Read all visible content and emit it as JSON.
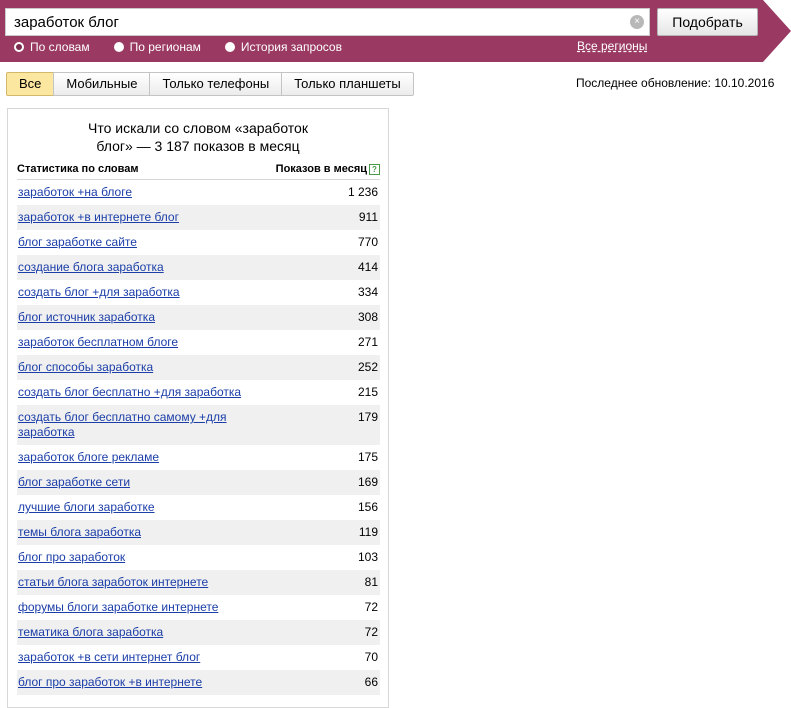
{
  "search": {
    "query": "заработок блог",
    "submit_label": "Подобрать",
    "modes": [
      "По словам",
      "По регионам",
      "История запросов"
    ],
    "regions_link": "Все регионы",
    "clear_symbol": "×"
  },
  "tabs": [
    "Все",
    "Мобильные",
    "Только телефоны",
    "Только планшеты"
  ],
  "last_update": "Последнее обновление: 10.10.2016",
  "panel": {
    "title_line1": "Что искали со словом «заработок",
    "title_line2": "блог» — 3 187 показов в месяц",
    "col_phrase": "Статистика по словам",
    "col_count": "Показов в месяц",
    "help_symbol": "?"
  },
  "rows": [
    {
      "phrase": "заработок +на блоге",
      "count": "1 236"
    },
    {
      "phrase": "заработок +в интернете блог",
      "count": "911"
    },
    {
      "phrase": "блог заработке сайте",
      "count": "770"
    },
    {
      "phrase": "создание блога заработка",
      "count": "414"
    },
    {
      "phrase": "создать блог +для заработка",
      "count": "334"
    },
    {
      "phrase": "блог источник заработка",
      "count": "308"
    },
    {
      "phrase": "заработок бесплатном блоге",
      "count": "271"
    },
    {
      "phrase": "блог способы заработка",
      "count": "252"
    },
    {
      "phrase": "создать блог бесплатно +для заработка",
      "count": "215"
    },
    {
      "phrase": "создать блог бесплатно самому +для заработка",
      "count": "179"
    },
    {
      "phrase": "заработок блоге рекламе",
      "count": "175"
    },
    {
      "phrase": "блог заработке сети",
      "count": "169"
    },
    {
      "phrase": "лучшие блоги заработке",
      "count": "156"
    },
    {
      "phrase": "темы блога заработка",
      "count": "119"
    },
    {
      "phrase": "блог про заработок",
      "count": "103"
    },
    {
      "phrase": "статьи блога заработок интернете",
      "count": "81"
    },
    {
      "phrase": "форумы блоги заработке интернете",
      "count": "72"
    },
    {
      "phrase": "тематика блога заработка",
      "count": "72"
    },
    {
      "phrase": "заработок +в сети интернет блог",
      "count": "70"
    },
    {
      "phrase": "блог про заработок +в интернете",
      "count": "66"
    }
  ]
}
